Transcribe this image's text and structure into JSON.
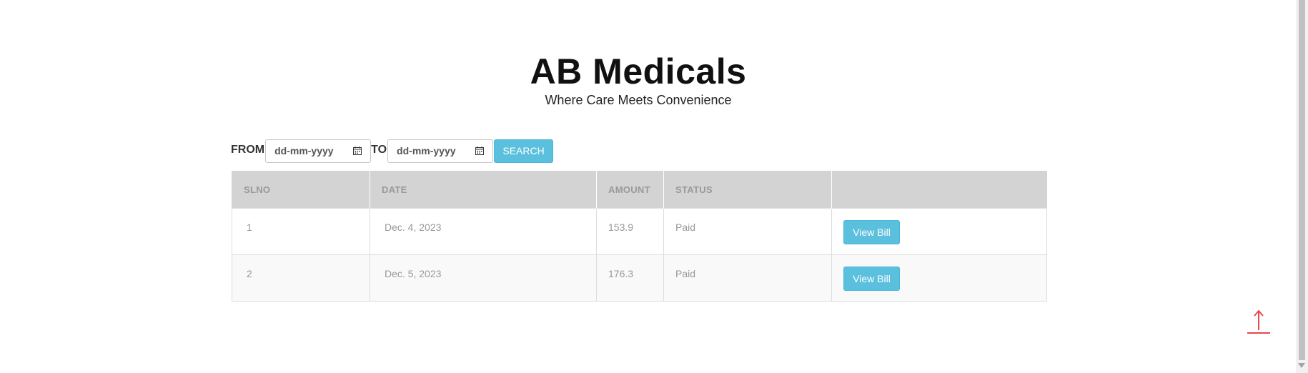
{
  "header": {
    "title": "AB Medicals",
    "subtitle": "Where Care Meets Convenience"
  },
  "filter": {
    "from_label": "FROM",
    "to_label": "TO",
    "from_placeholder": "dd-mm-yyyy",
    "to_placeholder": "dd-mm-yyyy",
    "search_label": "SEARCH",
    "icon": "calendar-icon"
  },
  "table": {
    "columns": [
      "SLNO",
      "DATE",
      "AMOUNT",
      "STATUS",
      ""
    ],
    "rows": [
      {
        "slno": "1",
        "date": "Dec. 4, 2023",
        "amount": "153.9",
        "status": "Paid",
        "action": "View Bill"
      },
      {
        "slno": "2",
        "date": "Dec. 5, 2023",
        "amount": "176.3",
        "status": "Paid",
        "action": "View Bill"
      }
    ]
  },
  "scroll_top": {
    "icon": "arrow-up-icon"
  },
  "colors": {
    "accent": "#5bc0de",
    "header_bg": "#d3d3d3",
    "arrow": "#e8474f"
  }
}
